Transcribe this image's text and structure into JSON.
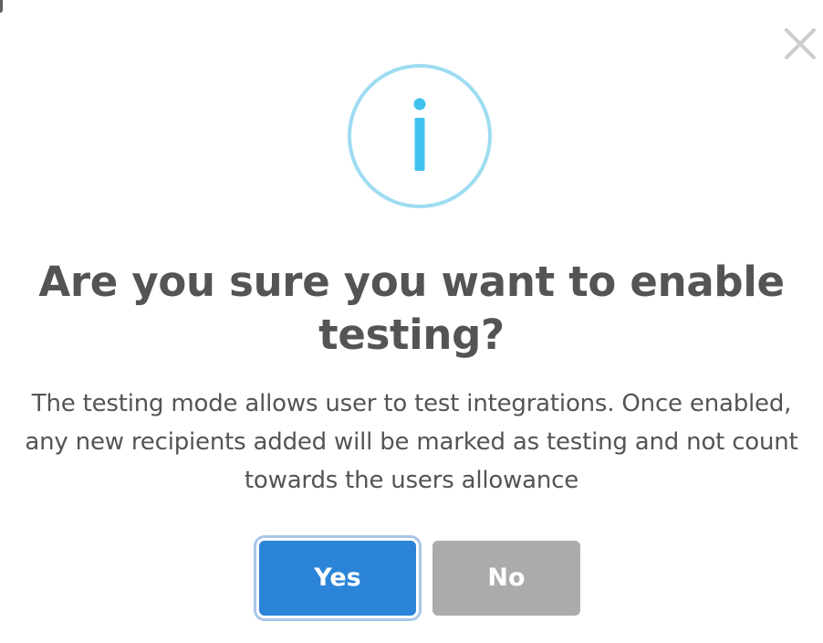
{
  "dialog": {
    "title": "Are you sure you want to enable testing?",
    "message": "The testing mode allows user to test integrations. Once enabled, any new recipients added will be marked as testing and not count towards the users allowance",
    "icon": "info-icon",
    "buttons": {
      "confirm_label": "Yes",
      "cancel_label": "No"
    },
    "close_icon": "close-icon"
  },
  "colors": {
    "icon_ring": "#9fdcf2",
    "icon_glyph": "#3fc3ee",
    "title_text": "#545454",
    "confirm_button": "#2b84d7",
    "cancel_button": "#ababab",
    "close_icon": "#cccccc"
  }
}
